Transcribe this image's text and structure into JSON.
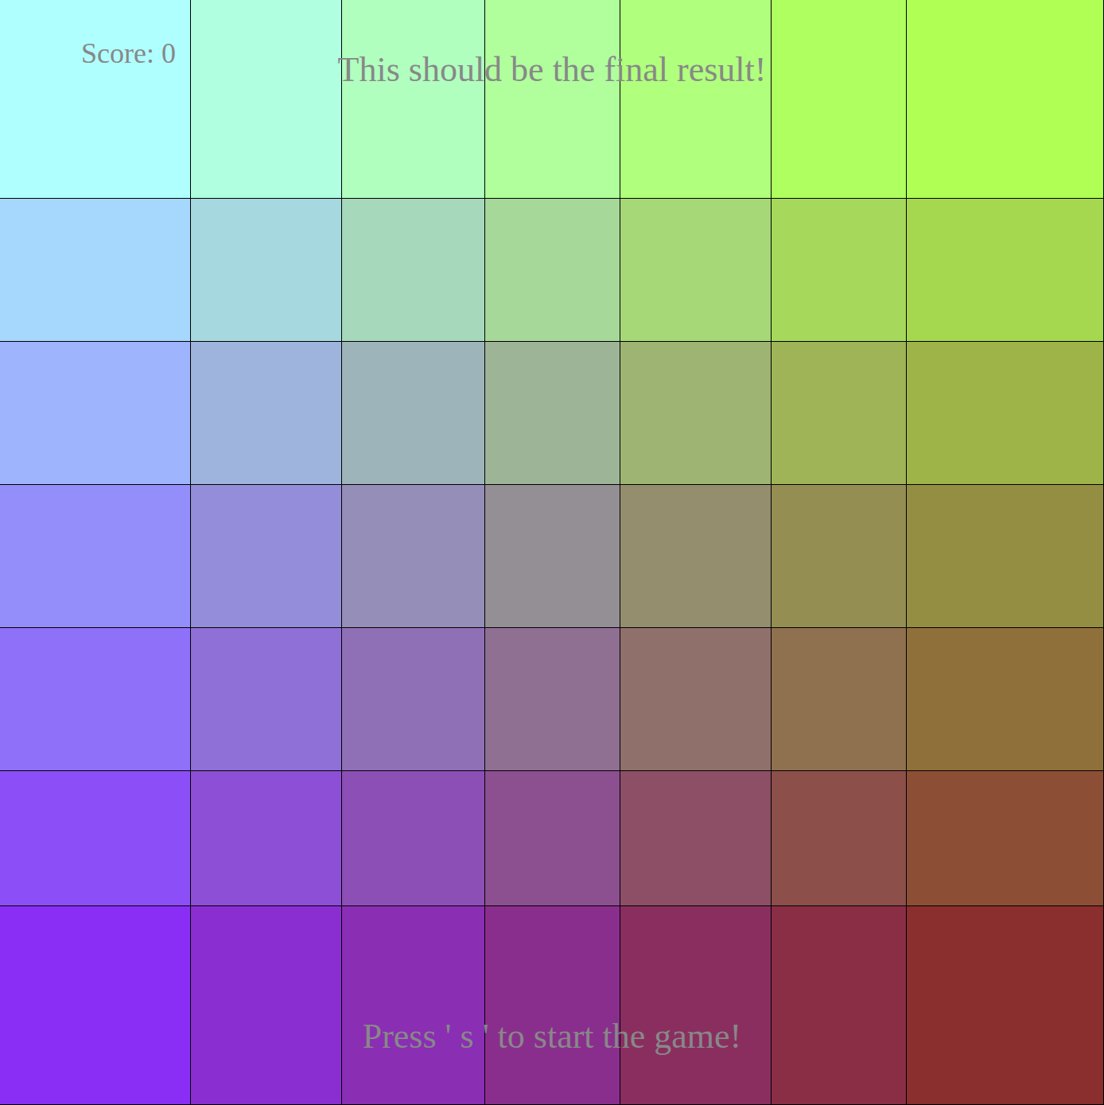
{
  "score": "Score: 0",
  "title": "This should be the final result!",
  "hint": "Press ' s ' to start the game!",
  "pieces": [
    [
      {
        "color": "#b0ffff"
      },
      {
        "color": "#b0ffe1"
      },
      {
        "color": "#b0ffbe"
      },
      {
        "color": "#b0ff9c"
      },
      {
        "color": "#b0ff7d"
      },
      {
        "color": "#b0ff60"
      },
      {
        "color": "#b0ff55"
      }
    ],
    [
      {
        "color": "#a6d8fd"
      },
      {
        "color": "#a6d8df"
      },
      {
        "color": "#a6d8bc"
      },
      {
        "color": "#a6d89a"
      },
      {
        "color": "#a6d878"
      },
      {
        "color": "#a6d85c"
      },
      {
        "color": "#a6d84f"
      }
    ],
    [
      {
        "color": "#9eb4fc"
      },
      {
        "color": "#9eb4dc"
      },
      {
        "color": "#9eb4bb"
      },
      {
        "color": "#9eb497"
      },
      {
        "color": "#9eb473"
      },
      {
        "color": "#9eb457"
      },
      {
        "color": "#9eb448"
      }
    ],
    [
      {
        "color": "#948efa"
      },
      {
        "color": "#948eda"
      },
      {
        "color": "#948eb9"
      },
      {
        "color": "#948e95"
      },
      {
        "color": "#948e6f"
      },
      {
        "color": "#948e53"
      },
      {
        "color": "#948e42"
      }
    ],
    [
      {
        "color": "#8f70f8"
      },
      {
        "color": "#8f70d7"
      },
      {
        "color": "#8f70b7"
      },
      {
        "color": "#8f7093"
      },
      {
        "color": "#8f706a"
      },
      {
        "color": "#8f704f"
      },
      {
        "color": "#8f703b"
      }
    ],
    [
      {
        "color": "#8c4ff7"
      },
      {
        "color": "#8c4fd5"
      },
      {
        "color": "#8c4fb6"
      },
      {
        "color": "#8c4f90"
      },
      {
        "color": "#8c4f65"
      },
      {
        "color": "#8c4f4a"
      },
      {
        "color": "#8c4f35"
      }
    ],
    [
      {
        "color": "#8a2ef5"
      },
      {
        "color": "#8a2ed2"
      },
      {
        "color": "#8a2eb4"
      },
      {
        "color": "#8a2e8e"
      },
      {
        "color": "#8a2e60"
      },
      {
        "color": "#8a2e46"
      },
      {
        "color": "#8a2e2e"
      }
    ]
  ]
}
